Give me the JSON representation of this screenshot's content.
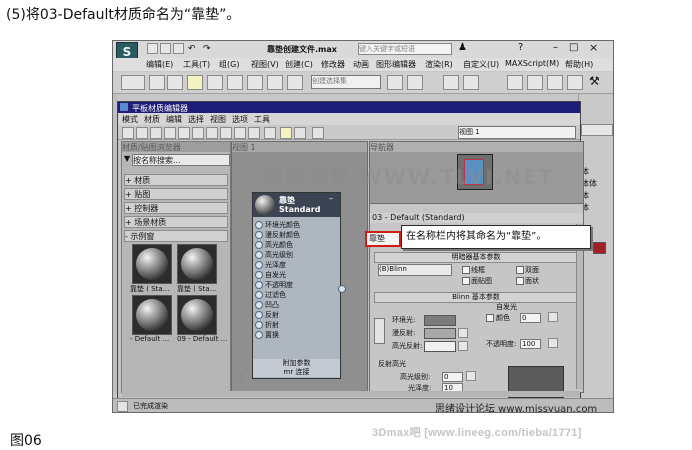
{
  "caption_top": "(5)将03-Default材质命名为“靠垫”。",
  "caption_bottom": "图06",
  "footer_watermark": "3Dmax吧  [www.lineeg.com/tieba/1771]",
  "app": {
    "logo": "S",
    "doc_title": "靠垫创建文件.max",
    "search_placeholder": "键入关键字或短语",
    "menu": [
      "编辑(E)",
      "工具(T)",
      "组(G)",
      "视图(V)",
      "创建(C)",
      "修改器",
      "动画",
      "图形编辑器",
      "渲染(R)",
      "自定义(U)",
      "MAXScript(M)",
      "帮助(H)"
    ],
    "selection_set": "创建选择集",
    "right_panel_rows": [
      "体",
      "体体",
      "体",
      "体"
    ]
  },
  "sme": {
    "title": "平板材质编辑器",
    "menu": [
      "模式",
      "材质",
      "编辑",
      "选择",
      "视图",
      "选项",
      "工具"
    ],
    "view_dropdown": "视图 1",
    "browser": {
      "header": "材质/贴图浏览器",
      "search_placeholder": "按名称搜索...",
      "groups": [
        "+ 材质",
        "+ 贴图",
        "+ 控制器",
        "+ 场景材质",
        "- 示例窗"
      ],
      "swatch_labels": [
        "靠垫 ( Sta...",
        "靠垫 ( Sta...",
        "- Default ...",
        "09 - Default ..."
      ]
    },
    "view_tab": "视图 1",
    "node": {
      "title": "靠垫",
      "subtitle": "Standard",
      "slots": [
        "环境光颜色",
        "漫反射颜色",
        "高光颜色",
        "高光级别",
        "光泽度",
        "自发光",
        "不透明度",
        "过滤色",
        "凹凸",
        "反射",
        "折射",
        "置换"
      ],
      "footer1": "附加参数",
      "footer2": "mr 连接"
    },
    "navigator_header": "导航器",
    "props": {
      "name_label": "03 - Default (Standard)",
      "name_value": "靠垫",
      "rollout_shader": "明暗器基本参数",
      "shader_value": "(B)Blinn",
      "checkboxes": [
        "线框",
        "双面",
        "面贴图",
        "面状"
      ],
      "rollout_blinn": "Blinn 基本参数",
      "self_illum": "自发光",
      "color_label": "颜色",
      "color_value": "0",
      "ambient_label": "环境光:",
      "diffuse_label": "漫反射:",
      "specular_label": "高光反射:",
      "opacity_label": "不透明度:",
      "opacity_value": "100",
      "spec_group": "反射高光",
      "spec_level_label": "高光级别:",
      "spec_level_value": "0",
      "gloss_label": "光泽度:",
      "gloss_value": "10"
    },
    "status": "已完成渲染",
    "status_watermark": "思绪设计论坛 www.missyuan.com"
  },
  "callout": "在名称栏内将其命名为“靠垫”。",
  "big_watermark": "腾龍視覺 WWW.TLVI.NET",
  "colors": {
    "title_blue": "#1e1e78",
    "node_header": "#3b4453",
    "highlight_red": "#d11a1a"
  }
}
